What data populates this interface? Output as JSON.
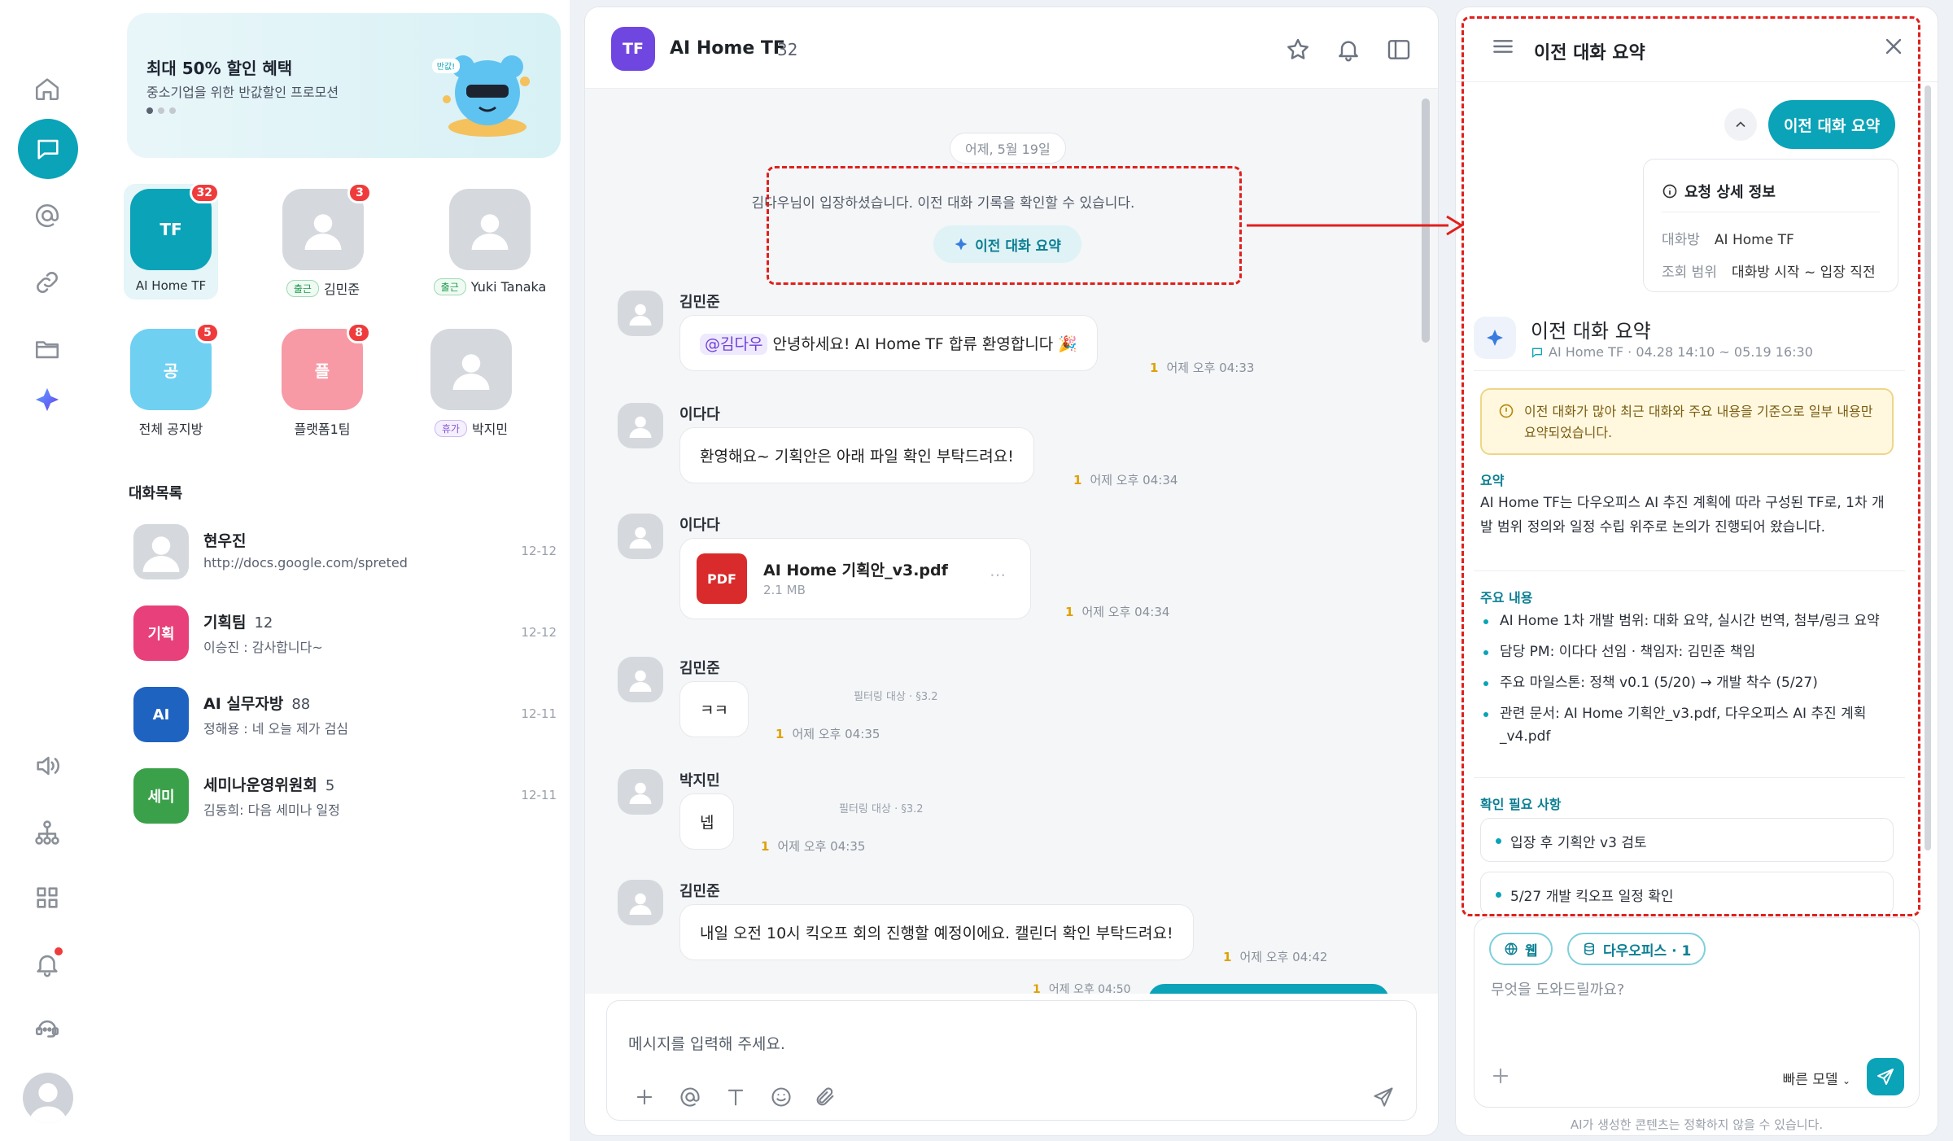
{
  "promo": {
    "title": "최대 50% 할인 혜택",
    "subtitle": "중소기업을 위한 반값할인 프로모션",
    "mascot_badge": "반값!"
  },
  "rooms": [
    {
      "abbr": "TF",
      "name": "AI Home TF",
      "badge": "32",
      "color": "#0aa3b8"
    },
    {
      "abbr": "",
      "name": "김민준",
      "badge": "3",
      "tag": "출근"
    },
    {
      "abbr": "",
      "name": "Yuki Tanaka",
      "badge": "",
      "tag": "출근"
    },
    {
      "abbr": "공",
      "name": "전체 공지방",
      "badge": "5",
      "color": "#6fd0f2"
    },
    {
      "abbr": "플",
      "name": "플랫폼1팀",
      "badge": "8",
      "color": "#f79aa6"
    },
    {
      "abbr": "",
      "name": "박지민",
      "badge": "",
      "tag": "휴가"
    }
  ],
  "conversation_list": {
    "label": "대화목록",
    "items": [
      {
        "abbr": "",
        "title": "현우진",
        "count": "",
        "snippet": "http://docs.google.com/spreted",
        "date": "12-12"
      },
      {
        "abbr": "기획",
        "title": "기획팀",
        "count": "12",
        "snippet": "이승진 : 감사합니다~",
        "date": "12-12",
        "color": "#e8407a"
      },
      {
        "abbr": "AI",
        "title": "AI 실무자방",
        "count": "88",
        "snippet": "정해용 : 네 오늘 제가 검심",
        "date": "12-11",
        "color": "#1f63c0"
      },
      {
        "abbr": "세미",
        "title": "세미나운영위원회",
        "count": "5",
        "snippet": "김동희: 다음 세미나 일정",
        "date": "12-11",
        "color": "#3aa14a"
      }
    ]
  },
  "chat": {
    "avatar": "TF",
    "title": "AI Home TF",
    "member_count": "32",
    "date_divider": "어제, 5월 19일",
    "system_message": "김다우님이 입장하셨습니다. 이전 대화 기록을 확인할 수 있습니다.",
    "summary_button": "이전 대화 요약",
    "messages": [
      {
        "sender": "김민준",
        "mention": "@김다우",
        "text": "안녕하세요! AI Home TF 합류 환영합니다 🎉",
        "unread": "1",
        "time": "어제 오후 04:33"
      },
      {
        "sender": "이다다",
        "text": "환영해요~ 기획안은 아래 파일 확인 부탁드려요!",
        "unread": "1",
        "time": "어제 오후 04:34"
      },
      {
        "sender": "이다다",
        "file_icon": "PDF",
        "file_name": "AI Home 기획안_v3.pdf",
        "file_size": "2.1 MB",
        "unread": "1",
        "time": "어제 오후 04:34"
      },
      {
        "sender": "김민준",
        "text": "ㅋㅋ",
        "filter": "필터링 대상 · §3.2",
        "unread": "1",
        "time": "어제 오후 04:35"
      },
      {
        "sender": "박지민",
        "text": "넵",
        "filter": "필터링 대상 · §3.2",
        "unread": "1",
        "time": "어제 오후 04:35"
      },
      {
        "sender": "김민준",
        "text": "내일 오전 10시 킥오프 회의 진행할 예정이에요. 캘린더 확인 부탁드려요!",
        "unread": "1",
        "time": "어제 오후 04:42"
      }
    ],
    "partial_time": "어제 오후 04:50",
    "input_placeholder": "메시지를 입력해 주세요."
  },
  "panel": {
    "title": "이전 대화 요약",
    "summary_button": "이전 대화 요약",
    "request": {
      "heading": "요청 상세 정보",
      "room_label": "대화방",
      "room_value": "AI Home TF",
      "range_label": "조회 범위",
      "range_value": "대화방 시작 ~ 입장 직전"
    },
    "summary_title": "이전 대화 요약",
    "summary_sub": "AI Home TF · 04.28 14:10 ~ 05.19 16:30",
    "warning": "이전 대화가 많아 최근 대화와 주요 내용을 기준으로 일부 내용만 요약되었습니다.",
    "summary_label": "요약",
    "summary_text": "AI Home TF는 다우오피스 AI 추진 계획에 따라 구성된 TF로, 1차 개발 범위 정의와 일정 수립 위주로 논의가 진행되어 왔습니다.",
    "key_label": "주요 내용",
    "key_points": [
      "AI Home 1차 개발 범위: 대화 요약, 실시간 번역, 첨부/링크 요약",
      "담당 PM: 이다다 선임 · 책임자: 김민준 책임",
      "주요 마일스톤: 정책 v0.1 (5/20) → 개발 착수 (5/27)",
      "관련 문서: AI Home 기획안_v3.pdf, 다우오피스 AI 추진 계획_v4.pdf"
    ],
    "check_label": "확인 필요 사항",
    "checks": [
      "입장 후 기획안 v3 검토",
      "5/27 개발 킥오프 일정 확인"
    ],
    "chips": [
      "웹",
      "다우오피스 · 1"
    ],
    "composer_placeholder": "무엇을 도와드릴까요?",
    "model": "빠른 모델",
    "disclaimer": "AI가 생성한 콘텐츠는 정확하지 않을 수 있습니다."
  },
  "colors": {
    "accent": "#0aa3b8",
    "annotation": "#e0201c",
    "badge": "#ef3b3b"
  }
}
